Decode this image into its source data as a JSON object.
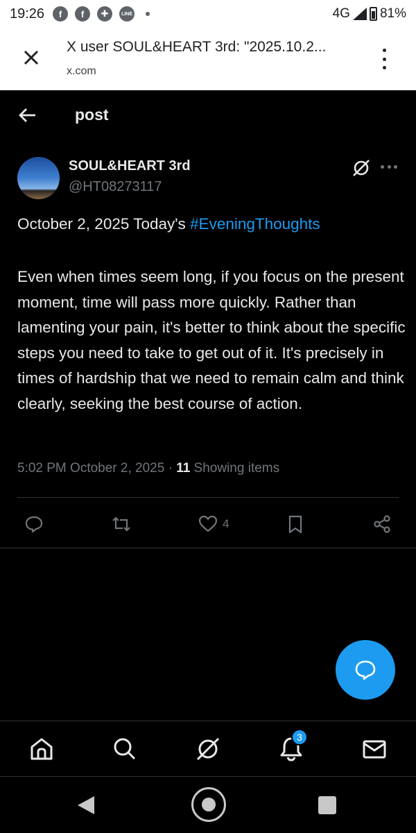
{
  "status_bar": {
    "time": "19:26",
    "network": "4G",
    "battery": "81%",
    "notification_icons": [
      "facebook-icon",
      "facebook-icon",
      "messenger-icon",
      "line-icon",
      "dot-icon"
    ]
  },
  "custom_tab": {
    "title": "X user SOUL&HEART 3rd: \"2025.10.2...",
    "url": "x.com"
  },
  "header": {
    "title": "post"
  },
  "post": {
    "author_name": "SOUL&HEART 3rd",
    "author_handle": "@HT08273117",
    "line1_prefix": "October 2, 2025 Today's ",
    "hashtag": "#EveningThoughts",
    "body": "Even when times seem long, if you focus on the present moment, time will pass more quickly. Rather than lamenting your pain, it's better to think about the specific steps you need to take to get out of it. It's precisely in times of hardship that we need to remain calm and think clearly, seeking the best course of action.",
    "timestamp": "5:02 PM October 2, 2025",
    "separator": " · ",
    "views_count": "11",
    "views_label": " Showing items",
    "like_count": "4"
  },
  "bottom_nav": {
    "notification_badge": "3"
  },
  "colors": {
    "accent": "#1d9bf0",
    "background": "#000000",
    "text": "#e7e9ea",
    "muted": "#71767b",
    "divider": "#2f3336"
  }
}
